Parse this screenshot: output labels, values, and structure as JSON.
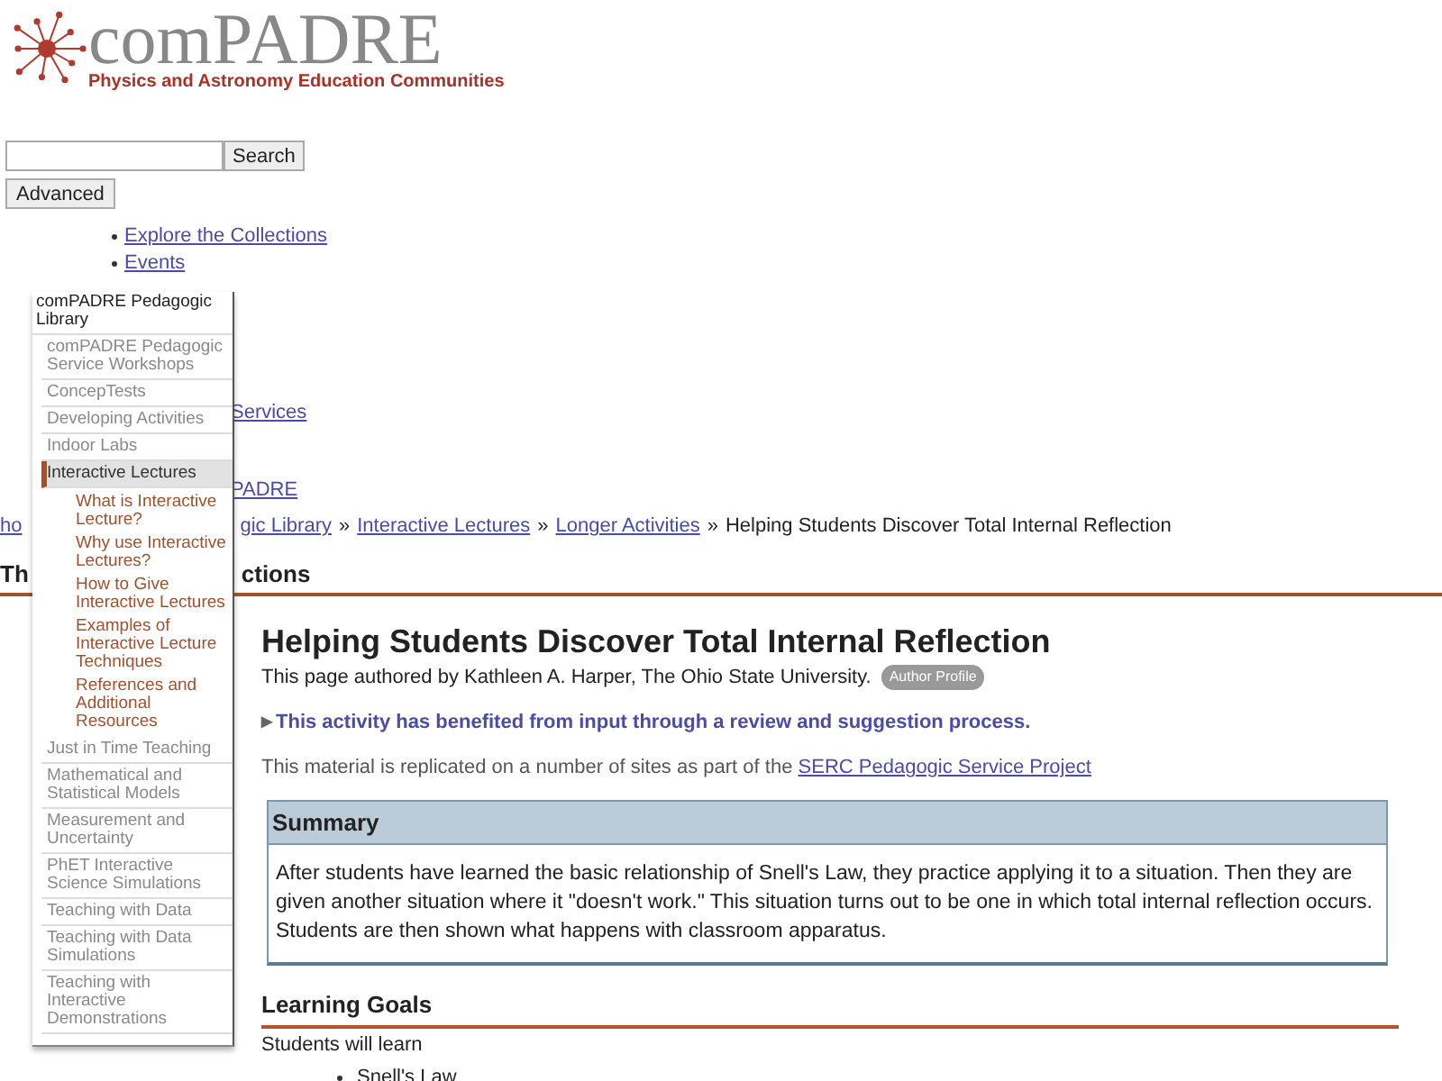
{
  "header": {
    "logo_title": "comPADRE",
    "logo_subtitle": "Physics and Astronomy Education Communities"
  },
  "search": {
    "button": "Search",
    "advanced": "Advanced"
  },
  "nav_links": [
    "Explore the Collections",
    "Events"
  ],
  "nav_fragments": [
    "Services",
    "PADRE"
  ],
  "breadcrumb": [
    {
      "kind": "link",
      "text": "ho"
    },
    {
      "kind": "link",
      "text": "gic Library"
    },
    {
      "kind": "sep",
      "text": "»"
    },
    {
      "kind": "link",
      "text": "Interactive Lectures"
    },
    {
      "kind": "sep",
      "text": "»"
    },
    {
      "kind": "link",
      "text": "Longer Activities"
    },
    {
      "kind": "sep",
      "text": "»"
    },
    {
      "kind": "text",
      "text": "Helping Students Discover Total Internal Reflection"
    }
  ],
  "section_heading_fragments": [
    "Th",
    "ctions"
  ],
  "menu": {
    "title": "comPADRE Pedagogic Library",
    "items": [
      {
        "label": "comPADRE Pedagogic Service Workshops",
        "selected": false
      },
      {
        "label": "ConcepTests",
        "selected": false
      },
      {
        "label": "Developing Activities",
        "selected": false
      },
      {
        "label": "Indoor Labs",
        "selected": false
      },
      {
        "label": "Interactive Lectures",
        "selected": true,
        "children": [
          "What is Interactive Lecture?",
          "Why use Interactive Lectures?",
          "How to Give Interactive Lectures",
          "Examples of Interactive Lecture Techniques",
          "References and Additional Resources"
        ]
      },
      {
        "label": "Just in Time Teaching",
        "selected": false
      },
      {
        "label": "Mathematical and Statistical Models",
        "selected": false
      },
      {
        "label": "Measurement and Uncertainty",
        "selected": false
      },
      {
        "label": "PhET Interactive Science Simulations",
        "selected": false
      },
      {
        "label": "Teaching with Data",
        "selected": false
      },
      {
        "label": "Teaching with Data Simulations",
        "selected": false
      },
      {
        "label": "Teaching with Interactive Demonstrations",
        "selected": false
      }
    ]
  },
  "article": {
    "title": "Helping Students Discover Total Internal Reflection",
    "author_line": "This page authored by Kathleen A. Harper, The Ohio State University.",
    "author_badge": "Author Profile",
    "review_marker": "▶",
    "review_note": "This activity has benefited from input through a review and suggestion process.",
    "replicated_text": "This material is replicated on a number of sites as part of the",
    "replicated_link": "SERC Pedagogic Service Project",
    "summary": {
      "heading": "Summary",
      "text": "After students have learned the basic relationship of Snell's Law, they practice applying it to a situation. Then they are given another situation where it \"doesn't work.\" This situation turns out to be one in which total internal reflection occurs. Students are then shown what happens with classroom apparatus."
    },
    "learning_goals": {
      "heading": "Learning Goals",
      "intro": "Students will learn",
      "items": [
        "Snell's Law"
      ]
    }
  }
}
